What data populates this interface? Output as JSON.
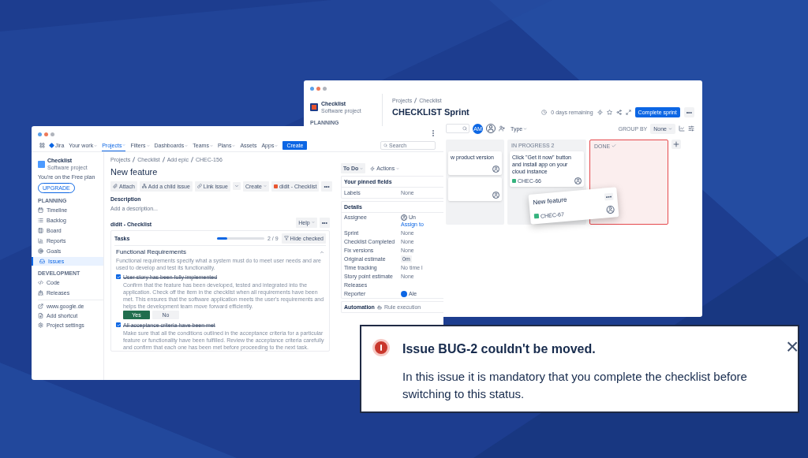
{
  "board_window": {
    "project": {
      "name": "Checklist",
      "type": "Software project"
    },
    "sidebar_section": "PLANNING",
    "breadcrumb": [
      "Projects",
      "Checklist"
    ],
    "title": "CHECKLIST Sprint",
    "days_remaining": "0 days remaining",
    "complete_button": "Complete sprint",
    "more": "•••",
    "avatar_initials": "AM",
    "type_filter": "Type",
    "group_by_label": "GROUP BY",
    "group_by_value": "None",
    "columns": [
      {
        "highlight": false,
        "cards": [
          {
            "title": "w product version",
            "assignee": true
          },
          {
            "assignee": true
          }
        ]
      },
      {
        "title": "IN PROGRESS 2",
        "highlight": false,
        "cards": [
          {
            "title": "Click \"Get it now\" button and install app on your cloud instance",
            "key": "CHEC-66",
            "assignee": true
          }
        ]
      },
      {
        "title": "DONE",
        "done_check": true,
        "highlight": true
      }
    ],
    "dragged_card": {
      "title": "New feature",
      "key": "CHEC-67",
      "more": "•••"
    }
  },
  "issue_window": {
    "logo": "Jira",
    "nav": [
      {
        "label": "Your work",
        "selected": false,
        "menu": true
      },
      {
        "label": "Projects",
        "selected": true,
        "menu": true
      },
      {
        "label": "Filters",
        "selected": false,
        "menu": true
      },
      {
        "label": "Dashboards",
        "selected": false,
        "menu": true
      },
      {
        "label": "Teams",
        "selected": false,
        "menu": true
      },
      {
        "label": "Plans",
        "selected": false,
        "menu": true
      },
      {
        "label": "Assets",
        "selected": false,
        "menu": false
      },
      {
        "label": "Apps",
        "selected": false,
        "menu": true
      }
    ],
    "create_button": "Create",
    "search_placeholder": "Search",
    "sidebar": {
      "project": "Checklist",
      "type": "Software project",
      "plan_note": "You're on the Free plan",
      "upgrade": "UPGRADE",
      "sections": [
        {
          "title": "PLANNING",
          "items": [
            {
              "label": "Timeline",
              "selected": false
            },
            {
              "label": "Backlog",
              "selected": false
            },
            {
              "label": "Board",
              "selected": false
            },
            {
              "label": "Reports",
              "selected": false
            },
            {
              "label": "Goals",
              "selected": false
            },
            {
              "label": "Issues",
              "selected": true
            }
          ]
        },
        {
          "title": "DEVELOPMENT",
          "items": [
            {
              "label": "Code",
              "selected": false
            },
            {
              "label": "Releases",
              "selected": false
            }
          ]
        }
      ],
      "links": [
        "www.google.de",
        "Add shortcut",
        "Project settings"
      ]
    },
    "breadcrumb": [
      "Projects",
      "Checklist",
      "Add epic",
      "CHEC-156"
    ],
    "title": "New feature",
    "actions": [
      "Attach",
      "Add a child issue",
      "Link issue",
      "Create",
      "didit - Checklist"
    ],
    "more": "•••",
    "description_label": "Description",
    "description_placeholder": "Add a description...",
    "checklist": {
      "title": "didit - Checklist",
      "help": "Help",
      "more": "•••",
      "tasks_label": "Tasks",
      "level": 0.22,
      "count": "2 / 9",
      "hide_checked": "Hide checked",
      "items": [
        {
          "kind": "section",
          "title": "Functional Requirements",
          "expanded": true,
          "description": "Functional requirements specify what a system must do to meet user needs and are used to develop and test its functionality."
        },
        {
          "kind": "task",
          "title": "User story has been fully implemented",
          "checked": true,
          "description": "Confirm that the feature has been developed, tested and integrated into the application. Check off the item in the checklist when all requirements have been met. This ensures that the software application meets the user's requirements and helps the development team move forward efficiently.",
          "answers": [
            {
              "label": "Yes",
              "selected": true
            },
            {
              "label": "No",
              "selected": false
            }
          ]
        },
        {
          "kind": "task",
          "title": "All acceptance criteria have been met",
          "checked": true,
          "description": "Make sure that all the conditions outlined in the acceptance criteria for a particular feature or functionality have been fulfilled. Review the acceptance criteria carefully and confirm that each one has been met before proceeding to the next task."
        }
      ]
    },
    "status": "To Do",
    "actions_menu": "Actions",
    "pinned_title": "Your pinned fields",
    "pinned": [
      {
        "label": "Labels",
        "value": "None"
      }
    ],
    "details_title": "Details",
    "details": [
      {
        "label": "Assignee",
        "value": "Un",
        "link": "Assign to",
        "kind": "person"
      },
      {
        "label": "Sprint",
        "value": "None"
      },
      {
        "label": "Checklist Completed",
        "value": "None"
      },
      {
        "label": "Fix versions",
        "value": "None"
      },
      {
        "label": "Original estimate",
        "value": "0m",
        "kind": "chip"
      },
      {
        "label": "Time tracking",
        "value": "No time l"
      },
      {
        "label": "Story point estimate",
        "value": "None"
      },
      {
        "label": "Releases",
        "kind": "heading"
      },
      {
        "label": "Reporter",
        "value": "Ale",
        "kind": "avatar"
      }
    ],
    "automation": "Automation",
    "rule": "Rule execution"
  },
  "toast": {
    "title": "Issue BUG-2 couldn't be moved.",
    "message": "In this issue it is mandatory that you complete the checklist before switching to this status.",
    "close": "×"
  }
}
